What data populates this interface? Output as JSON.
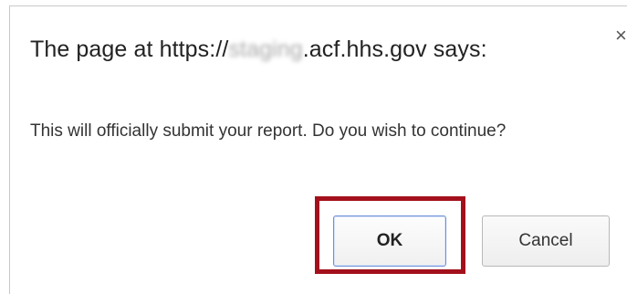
{
  "dialog": {
    "title_prefix": "The page at https://",
    "title_redacted": "staging",
    "title_suffix": ".acf.hhs.gov says:",
    "close_glyph": "×",
    "message": "This will officially submit your report.  Do you wish to continue?",
    "ok_label": "OK",
    "cancel_label": "Cancel"
  },
  "colors": {
    "highlight": "#a3101c",
    "ok_focus_border": "#6d8fd6"
  }
}
